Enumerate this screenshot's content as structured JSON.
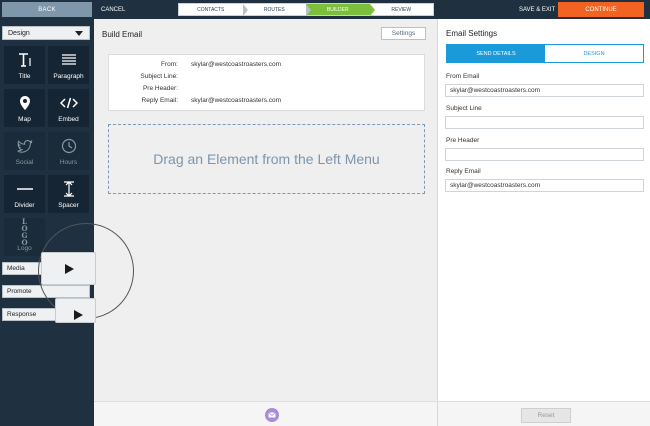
{
  "topbar": {
    "back_label": "BACK",
    "cancel_label": "CANCEL",
    "steps": [
      {
        "label": "CONTACTS",
        "active": false
      },
      {
        "label": "ROUTES",
        "active": false
      },
      {
        "label": "BUILDER",
        "active": true
      },
      {
        "label": "REVIEW",
        "active": false
      }
    ],
    "save_exit_label": "SAVE & EXIT",
    "continue_label": "CONTINUE"
  },
  "sidebar": {
    "dropdown_value": "Design",
    "tiles": [
      {
        "label": "Title",
        "icon": "title-icon",
        "enabled": true
      },
      {
        "label": "Paragraph",
        "icon": "paragraph-icon",
        "enabled": true
      },
      {
        "label": "Map",
        "icon": "map-pin-icon",
        "enabled": true
      },
      {
        "label": "Embed",
        "icon": "code-icon",
        "enabled": true
      },
      {
        "label": "Social",
        "icon": "twitter-icon",
        "enabled": false
      },
      {
        "label": "Hours",
        "icon": "clock-icon",
        "enabled": false
      },
      {
        "label": "Divider",
        "icon": "divider-icon",
        "enabled": true
      },
      {
        "label": "Spacer",
        "icon": "spacer-icon",
        "enabled": true
      },
      {
        "label": "Logo",
        "icon": "logo-icon",
        "enabled": false
      }
    ],
    "logo_tile_text": "LO GO",
    "categories": [
      "Media",
      "Promote",
      "Response"
    ]
  },
  "canvas": {
    "title": "Build Email",
    "settings_label": "Settings",
    "email_fields": [
      {
        "key": "From:",
        "value": "skylar@westcoastroasters.com"
      },
      {
        "key": "Subject Line:",
        "value": ""
      },
      {
        "key": "Pre Header:",
        "value": ""
      },
      {
        "key": "Reply Email:",
        "value": "skylar@westcoastroasters.com"
      }
    ],
    "dropzone_text": "Drag an Element from the Left Menu"
  },
  "settings_panel": {
    "title": "Email Settings",
    "tabs": [
      {
        "label": "SEND DETAILS",
        "active": true
      },
      {
        "label": "DESIGN",
        "active": false
      }
    ],
    "from_email_label": "From Email",
    "from_email_value": "skylar@westcoastroasters.com",
    "subject_label": "Subject Line",
    "subject_value": "",
    "pre_header_label": "Pre Header",
    "pre_header_value": "",
    "reply_email_label": "Reply Email",
    "reply_email_value": "skylar@westcoastroasters.com",
    "reset_label": "Reset"
  },
  "colors": {
    "nav_bg": "#1f3140",
    "continue": "#f26322",
    "active_step": "#7bbf3a",
    "tab_accent": "#1a9ad9",
    "mail_button": "#a98bd9"
  }
}
